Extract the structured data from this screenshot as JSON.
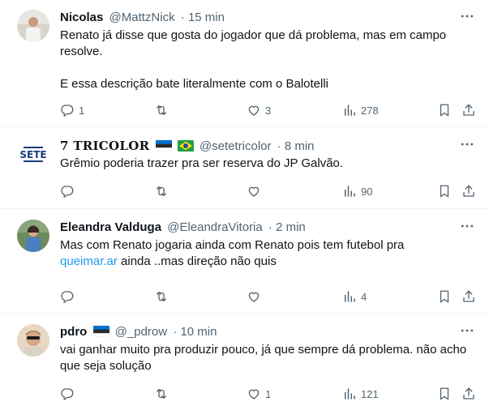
{
  "tweets": [
    {
      "name": "Nicolas",
      "handle": "@MattzNick",
      "time": "· 15 min",
      "lines": [
        "Renato já disse que gosta do jogador que dá problema, mas em campo resolve.",
        "E essa descrição bate literalmente com o Balotelli"
      ],
      "replies": "1",
      "retweets": "",
      "likes": "3",
      "views": "278"
    },
    {
      "name": "7 TRICOLOR",
      "handle": "@setetricolor",
      "time": "· 8 min",
      "avatar_text": "SETE",
      "lines": [
        "Grêmio poderia trazer pra ser reserva do JP Galvão."
      ],
      "replies": "",
      "retweets": "",
      "likes": "",
      "views": "90"
    },
    {
      "name": "Eleandra Valduga",
      "handle": "@EleandraVitoria",
      "time": "· 2 min",
      "line1": "Mas com Renato jogaria ainda com Renato pois tem futebol  pra",
      "link": "queimar.ar",
      "line2_rest": " ainda ..mas direção  não quis",
      "replies": "",
      "retweets": "",
      "likes": "",
      "views": "4"
    },
    {
      "name": "pdro",
      "handle": "@_pdrow",
      "time": "· 10 min",
      "lines": [
        "vai ganhar muito pra produzir pouco, já que sempre dá problema. não acho que seja solução"
      ],
      "replies": "",
      "retweets": "",
      "likes": "1",
      "views": "121"
    }
  ],
  "colors": {
    "text": "#0f1419",
    "secondary": "#536471",
    "link": "#1d9bf0",
    "divider": "#eff3f4"
  },
  "icons": [
    "reply-icon",
    "retweet-icon",
    "like-icon",
    "views-icon",
    "bookmark-icon",
    "share-icon",
    "more-icon",
    "estonia-flag-icon",
    "brazil-flag-icon"
  ]
}
